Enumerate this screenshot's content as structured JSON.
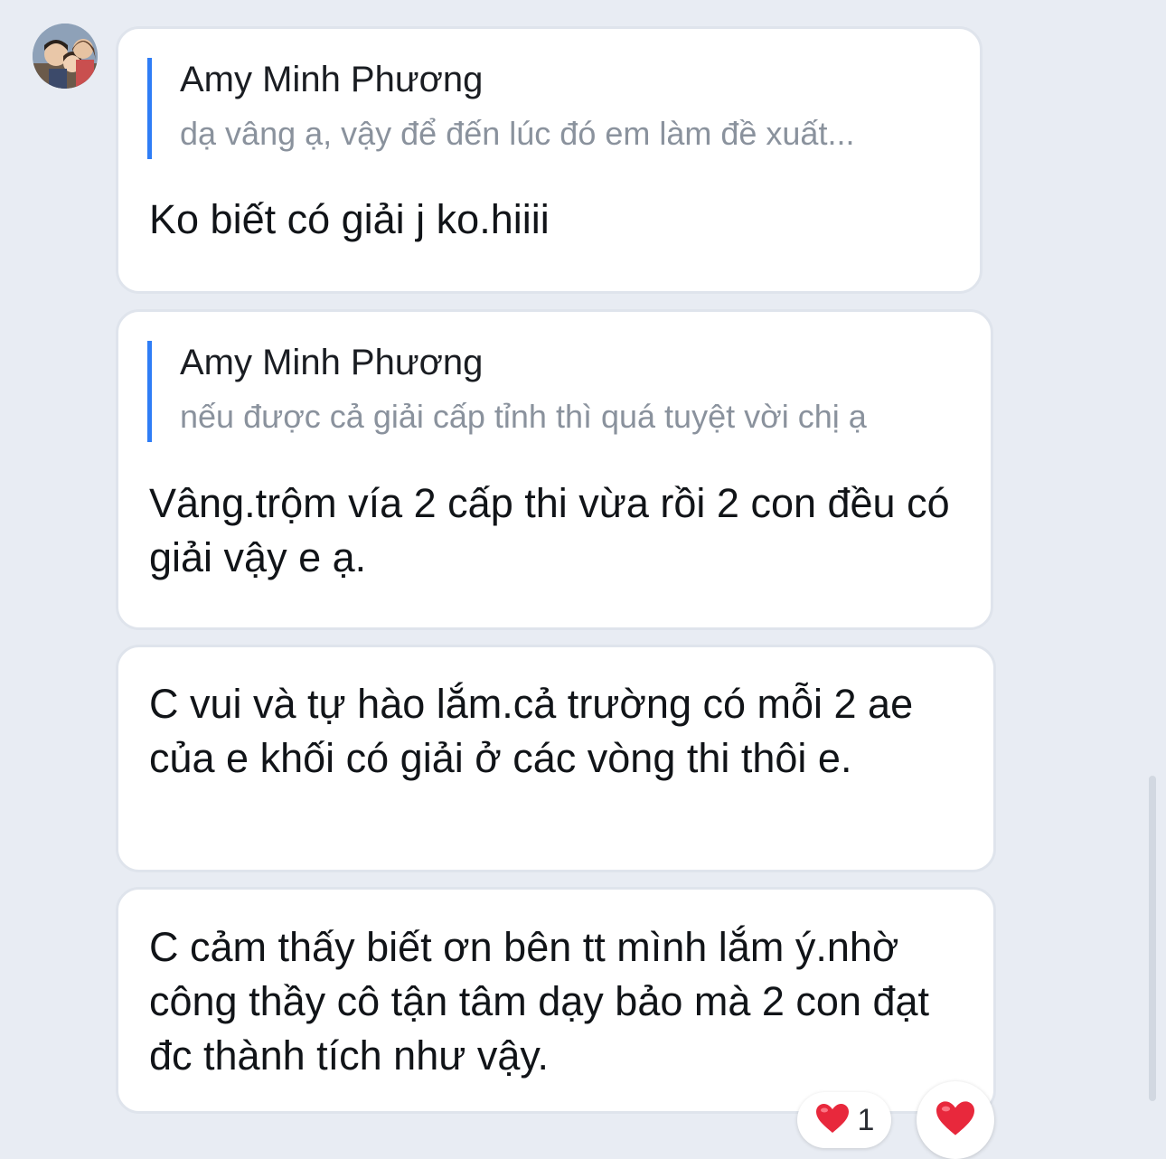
{
  "colors": {
    "background": "#e8ecf3",
    "bubble": "#ffffff",
    "quote_bar": "#2f7df6",
    "quote_text": "#8a929d",
    "heart": "#e8283c"
  },
  "avatar": {
    "icon": "profile-photo"
  },
  "messages": [
    {
      "quote_name": "Amy Minh Phương",
      "quote_text": "dạ vâng ạ, vậy để đến lúc đó em làm đề xuất...",
      "text": "Ko biết có giải j ko.hiiii"
    },
    {
      "quote_name": "Amy Minh Phương",
      "quote_text": "nếu được cả giải cấp tỉnh thì quá tuyệt vời chị ạ",
      "text": "Vâng.trộm vía 2 cấp thi vừa rồi 2 con đều có giải vậy e ạ."
    },
    {
      "text": "C vui và tự hào lắm.cả trường có mỗi 2 ae của e khối có giải ở các vòng thi thôi e."
    },
    {
      "text": "C cảm thấy biết ơn bên tt mình lắm ý.nhờ công thầy cô tận tâm dạy bảo mà 2 con đạt đc thành tích như vậy."
    }
  ],
  "reaction": {
    "icon": "heart-icon",
    "count": "1"
  },
  "react_button": {
    "icon": "heart-icon"
  }
}
